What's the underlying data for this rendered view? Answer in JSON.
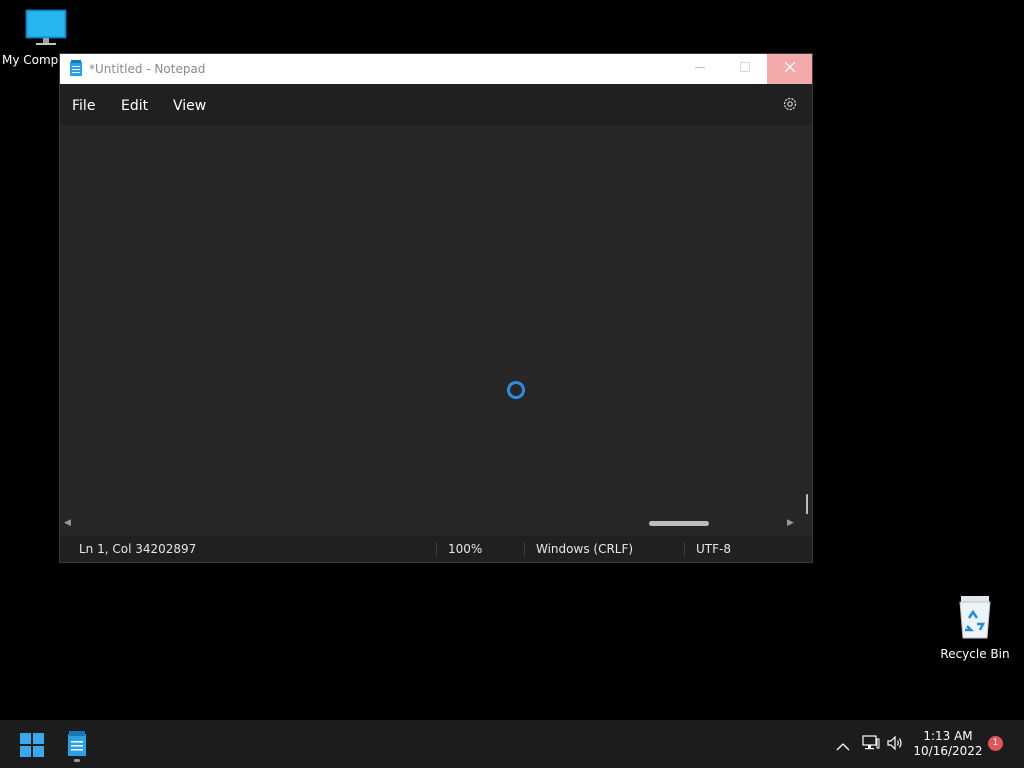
{
  "desktop": {
    "icons": [
      {
        "label": "My Compu"
      },
      {
        "label": "Recycle Bin"
      }
    ]
  },
  "notepad": {
    "title": "*Untitled - Notepad",
    "menu": {
      "file": "File",
      "edit": "Edit",
      "view": "View"
    },
    "status": {
      "position": "Ln 1, Col 34202897",
      "zoom": "100%",
      "line_endings": "Windows (CRLF)",
      "encoding": "UTF-8"
    }
  },
  "taskbar": {
    "time": "1:13 AM",
    "date": "10/16/2022",
    "notification_count": "1"
  },
  "colors": {
    "accent": "#2b8fe0",
    "close_hover": "#f2aaaa",
    "window_bg": "#272727",
    "menubar_bg": "#202020",
    "taskbar_bg": "#1c1c1c"
  }
}
